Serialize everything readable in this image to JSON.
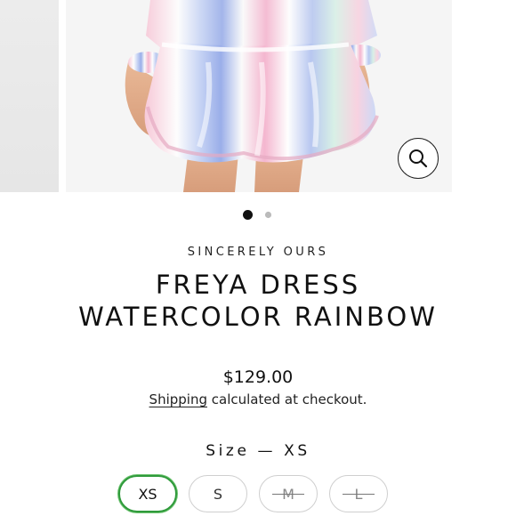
{
  "product": {
    "vendor": "SINCERELY OURS",
    "title_line1": "FREYA DRESS",
    "title_line2": "WATERCOLOR RAINBOW",
    "price": "$129.00",
    "shipping_link": "Shipping",
    "shipping_rest": " calculated at checkout."
  },
  "gallery": {
    "current_slide": 1,
    "slide_count": 2,
    "zoom_icon": "magnifier-icon"
  },
  "size": {
    "label": "Size — XS",
    "options": [
      {
        "label": "XS",
        "state": "selected"
      },
      {
        "label": "S",
        "state": "available"
      },
      {
        "label": "M",
        "state": "sold-out"
      },
      {
        "label": "L",
        "state": "sold-out"
      }
    ]
  },
  "colors": {
    "selected_border": "#2f9a3b",
    "text": "#111111"
  }
}
